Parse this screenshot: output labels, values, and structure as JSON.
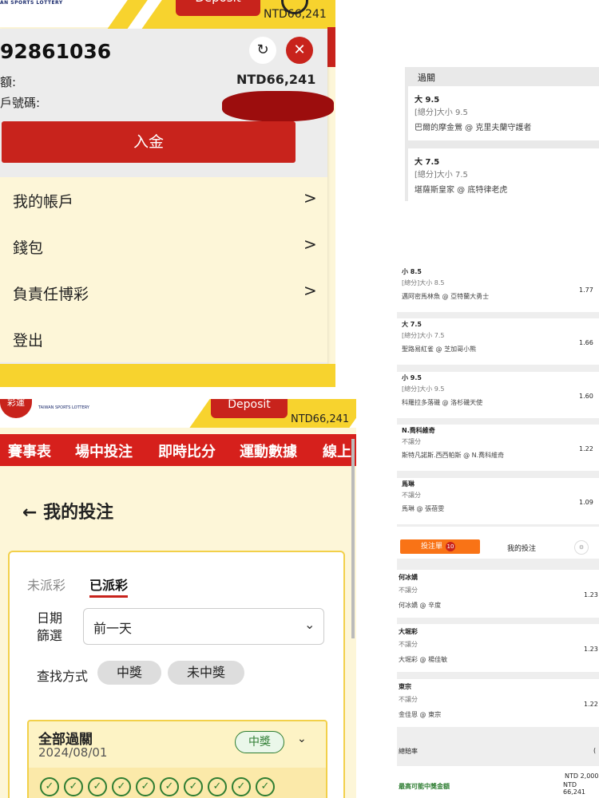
{
  "panel_account": {
    "logo_text": "AN SPORTS LOTTERY",
    "deposit_label": "Deposit",
    "balance_top": "NTD66,241",
    "account_number": "92861036",
    "refresh_icon": "↻",
    "close_icon": "✕",
    "balance_label": "額:",
    "balance_value": "NTD66,241",
    "account_label": "戶號碼:",
    "deposit_button": "入金",
    "menu": [
      {
        "label": "我的帳戶",
        "chevron": ">"
      },
      {
        "label": "錢包",
        "chevron": ">"
      },
      {
        "label": "負責任博彩",
        "chevron": ">"
      },
      {
        "label": "登出"
      }
    ]
  },
  "panel_mybets": {
    "logo_text": "彩運",
    "logo_sub": "TAIWAN SPORTS LOTTERY",
    "deposit_label": "Deposit",
    "balance": "NTD66,241",
    "nav": [
      "賽事表",
      "場中投注",
      "即時比分",
      "運動數據",
      "線上"
    ],
    "back_arrow": "←",
    "title": "我的投注",
    "tab_unsettled": "未派彩",
    "tab_settled": "已派彩",
    "date_filter_label": "日期篩選",
    "date_filter_value": "前一天",
    "dropdown_arrow": "⌄",
    "search_label": "查找方式",
    "filter_win": "中獎",
    "filter_lose": "未中獎",
    "bet_title": "全部過關",
    "bet_date": "2024/08/01",
    "bet_status": "中獎",
    "bet_chevron": "⌄",
    "check_mark": "✓",
    "check_count": 10
  },
  "panel_parlay": {
    "header": "過關",
    "items": [
      {
        "selection": "大 9.5",
        "market": "[總分]大小 9.5",
        "match": "巴爾的摩金鶯 @ 克里夫蘭守護者"
      },
      {
        "selection": "大 7.5",
        "market": "[總分]大小 7.5",
        "match": "堪薩斯皇家 @ 底特律老虎"
      }
    ]
  },
  "panel_singles": {
    "items": [
      {
        "selection": "小 8.5",
        "market": "[總分]大小 8.5",
        "match": "邁阿密馬林魚 @ 亞特蘭大勇士",
        "odds": "1.77"
      },
      {
        "selection": "大 7.5",
        "market": "[總分]大小 7.5",
        "match": "聖路易紅雀 @ 芝加哥小熊",
        "odds": "1.66"
      },
      {
        "selection": "小 9.5",
        "market": "[總分]大小 9.5",
        "match": "科羅拉多落磯 @ 洛杉磯天使",
        "odds": "1.60"
      },
      {
        "selection": "N.喬科維奇",
        "market": "不讓分",
        "match": "斯特凡諾斯.西西帕斯 @ N.喬科維奇",
        "odds": "1.22"
      },
      {
        "selection": "馬琳",
        "market": "不讓分",
        "match": "馬琳 @ 張蓓雯",
        "odds": "1.09"
      }
    ]
  },
  "panel_slip": {
    "tab_slip": "投注單",
    "slip_count": "10",
    "tab_mybets": "我的投注",
    "settings_icon": "⚙",
    "items": [
      {
        "selection": "何冰嬌",
        "market": "不讓分",
        "match": "何冰嬌 @ 辛度",
        "odds": "1.23"
      },
      {
        "selection": "大堀彩",
        "market": "不讓分",
        "match": "大堀彩 @ 楊佳敏",
        "odds": "1.23"
      },
      {
        "selection": "東宗",
        "market": "不讓分",
        "match": "金佳恩 @ 東宗",
        "odds": "1.22"
      }
    ],
    "total_odds_label": "總賠率",
    "total_odds_value": "(",
    "max_win_label": "最高可能中獎金額",
    "max_win_value1": "NTD 2,000",
    "max_win_value2": "NTD 66,241"
  }
}
